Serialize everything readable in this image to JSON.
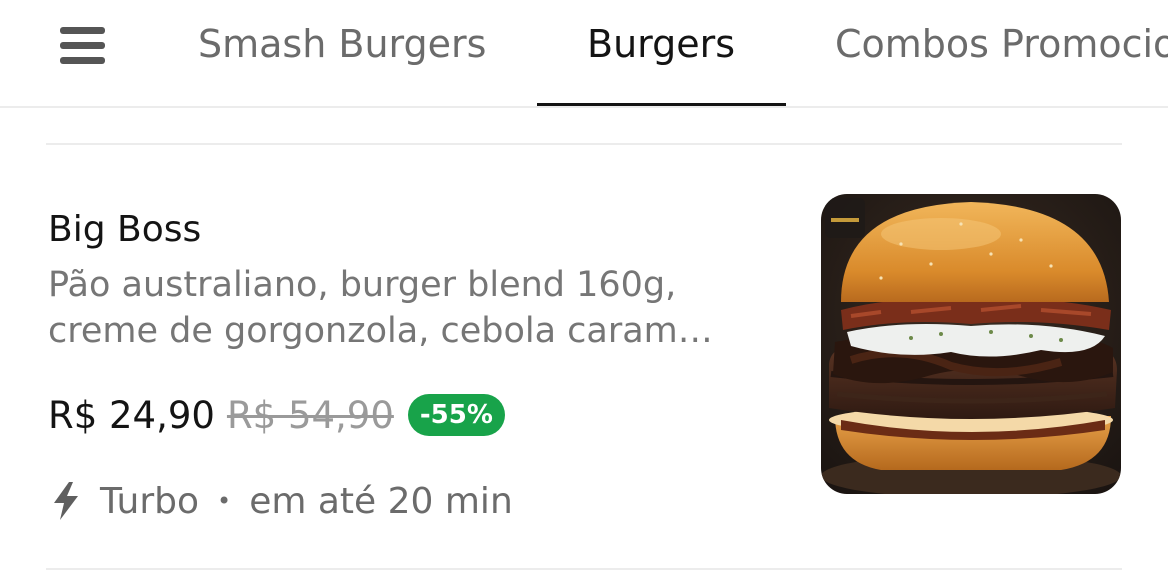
{
  "tabs": [
    {
      "label": "Smash Burgers",
      "active": false
    },
    {
      "label": "Burgers",
      "active": true
    },
    {
      "label": "Combos Promocionais",
      "active": false
    }
  ],
  "item": {
    "name": "Big Boss",
    "description_line1": "Pão australiano, burger blend 160g,",
    "description_line2": "creme de gorgonzola, cebola caram…",
    "price": "R$ 24,90",
    "old_price": "R$ 54,90",
    "discount": "-55%",
    "delivery_mode": "Turbo",
    "separator": "•",
    "delivery_time": "em até 20 min"
  },
  "icons": {
    "menu": "menu-icon",
    "delivery": "lightning-bolt-icon"
  },
  "colors": {
    "accent": "#141414",
    "discount_badge": "#18a34a",
    "muted_text": "#767676"
  }
}
